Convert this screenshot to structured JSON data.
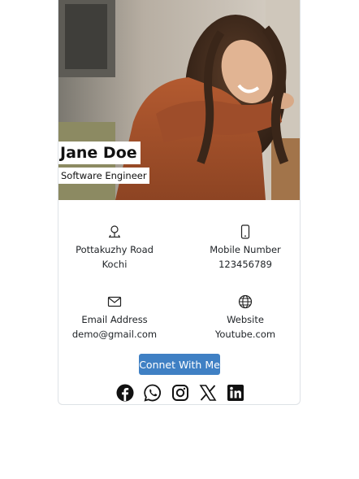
{
  "profile": {
    "name": "Jane Doe",
    "role": "Software Engineer"
  },
  "details": {
    "address": {
      "icon": "person-pin-icon",
      "line1": "Pottakuzhy Road",
      "line2": "Kochi"
    },
    "mobile": {
      "icon": "mobile-phone-icon",
      "line1": "Mobile Number",
      "line2": "123456789"
    },
    "email": {
      "icon": "envelope-icon",
      "line1": "Email Address",
      "line2": "demo@gmail.com"
    },
    "website": {
      "icon": "globe-icon",
      "line1": "Website",
      "line2": "Youtube.com"
    }
  },
  "connect_button": "Connet With Me",
  "socials": [
    "facebook-icon",
    "whatsapp-icon",
    "instagram-icon",
    "x-icon",
    "linkedin-icon"
  ],
  "colors": {
    "button": "#3f80c4",
    "sweater": "#a24f2c"
  }
}
